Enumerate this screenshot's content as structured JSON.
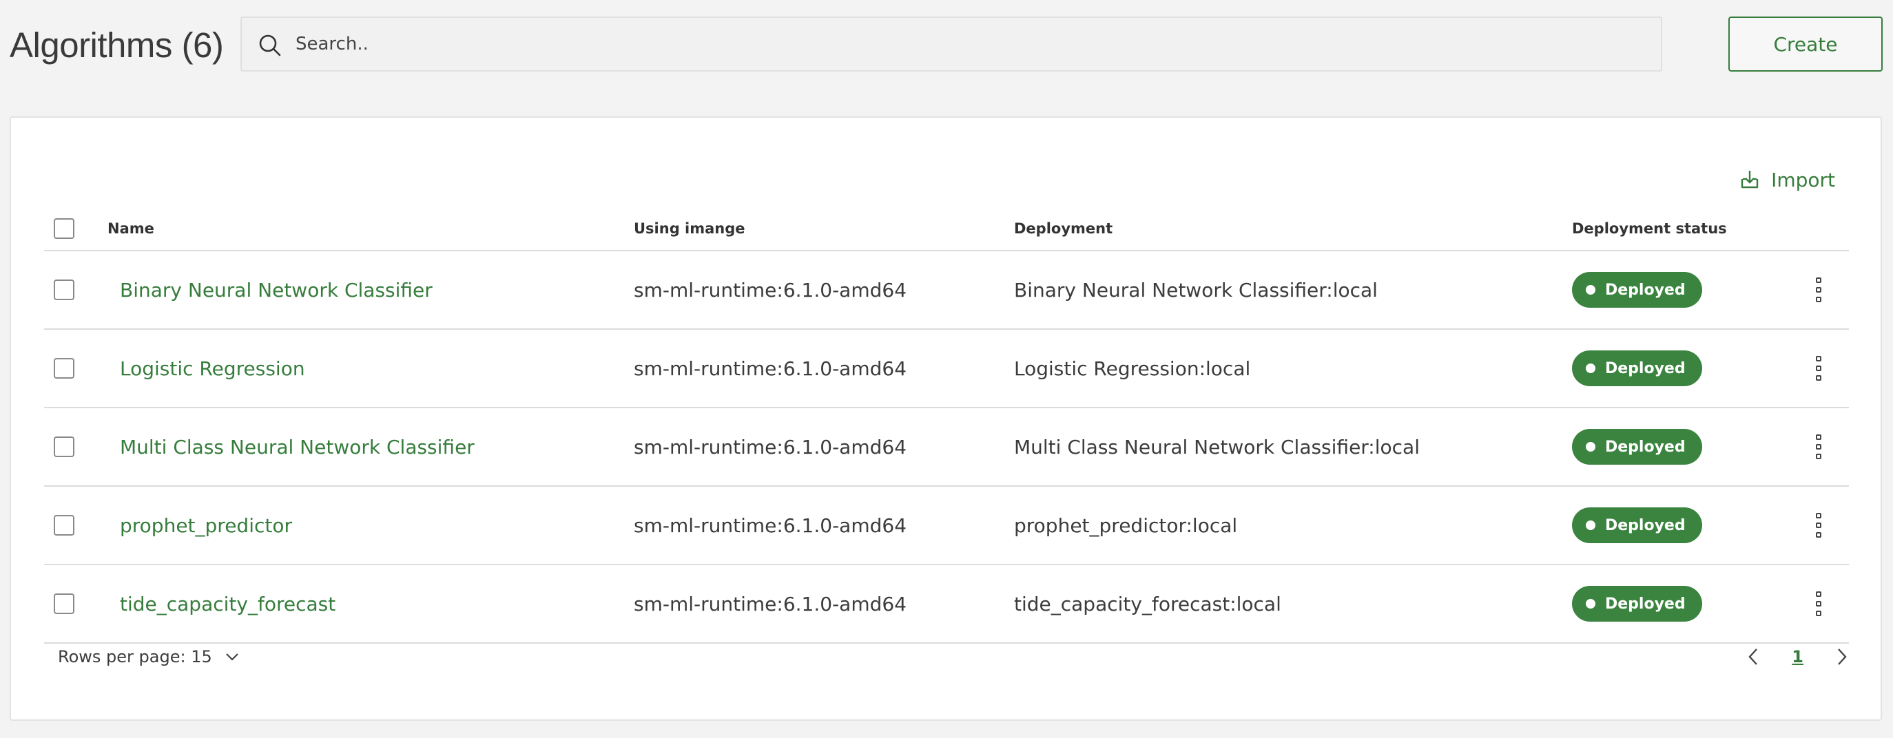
{
  "header": {
    "title": "Algorithms (6)",
    "search_placeholder": "Search..",
    "create_label": "Create"
  },
  "toolbar": {
    "import_label": "Import"
  },
  "table": {
    "columns": [
      "Name",
      "Using imange",
      "Deployment",
      "Deployment status"
    ],
    "rows": [
      {
        "name": "Binary Neural Network Classifier",
        "image": "sm-ml-runtime:6.1.0-amd64",
        "deployment": "Binary Neural Network Classifier:local",
        "status": "Deployed"
      },
      {
        "name": "Logistic Regression",
        "image": "sm-ml-runtime:6.1.0-amd64",
        "deployment": "Logistic Regression:local",
        "status": "Deployed"
      },
      {
        "name": "Multi Class Neural Network Classifier",
        "image": "sm-ml-runtime:6.1.0-amd64",
        "deployment": "Multi Class Neural Network Classifier:local",
        "status": "Deployed"
      },
      {
        "name": "prophet_predictor",
        "image": "sm-ml-runtime:6.1.0-amd64",
        "deployment": "prophet_predictor:local",
        "status": "Deployed"
      },
      {
        "name": "tide_capacity_forecast",
        "image": "sm-ml-runtime:6.1.0-amd64",
        "deployment": "tide_capacity_forecast:local",
        "status": "Deployed"
      }
    ]
  },
  "footer": {
    "rows_per_page_label": "Rows per page: 15",
    "current_page": "1"
  },
  "colors": {
    "accent": "#367d3c",
    "status_deployed": "#3b8440",
    "background": "#f3f3f3"
  },
  "icons": {
    "search": "search-icon",
    "import": "import-icon",
    "row_menu": "kebab-menu-icon",
    "rows_dropdown": "chevron-down-icon",
    "prev": "chevron-left-icon",
    "next": "chevron-right-icon"
  }
}
